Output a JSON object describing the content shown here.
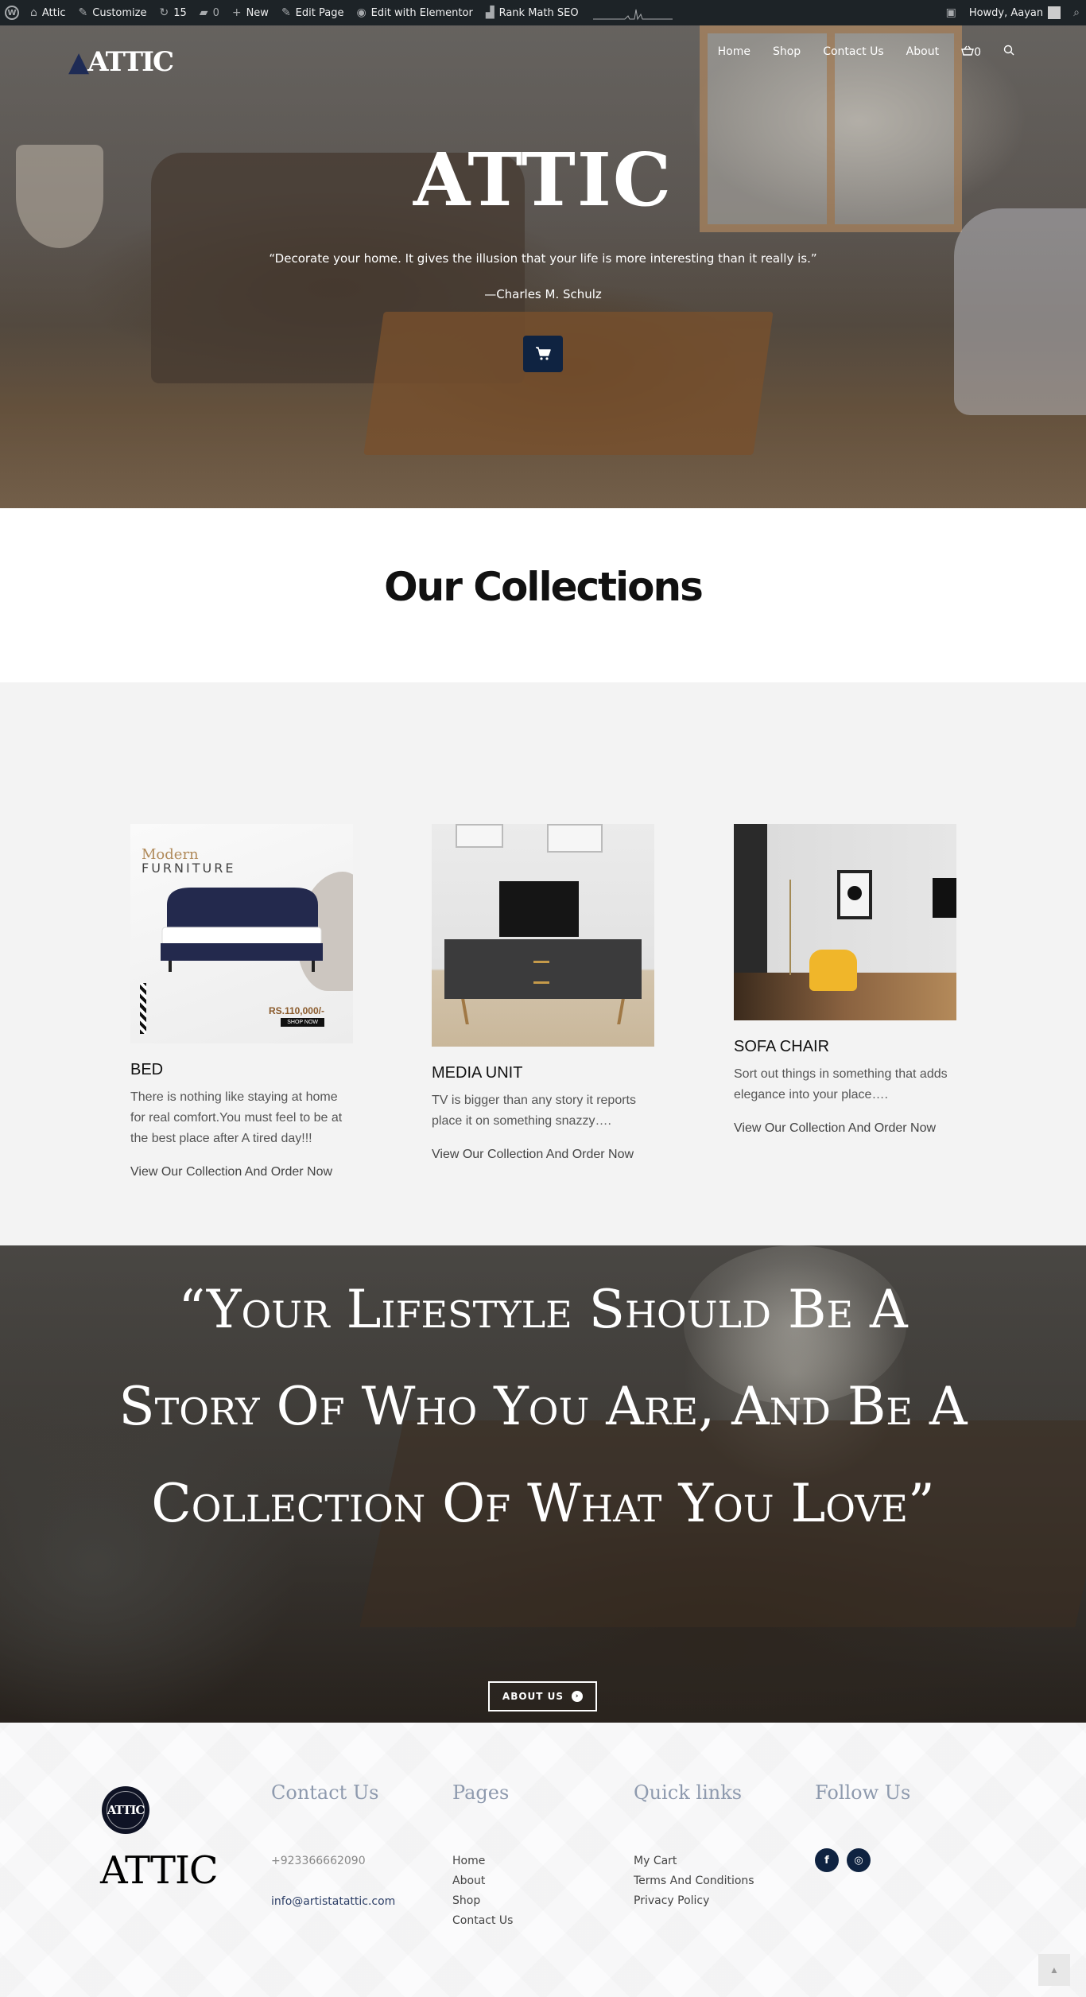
{
  "adminbar": {
    "site": "Attic",
    "customize": "Customize",
    "updates": "15",
    "comments": "0",
    "new": "New",
    "edit_page": "Edit Page",
    "elementor": "Edit with Elementor",
    "rankmath": "Rank Math SEO",
    "howdy": "Howdy, Aayan"
  },
  "nav": {
    "logo": "ATTIC",
    "items": [
      "Home",
      "Shop",
      "Contact Us",
      "About"
    ],
    "cart_count": "0"
  },
  "hero": {
    "title": "ATTIC",
    "quote": "“Decorate your home. It gives the illusion that your life is more interesting than it really is.”",
    "author": "—Charles M. Schulz"
  },
  "collections": {
    "heading": "Our Collections",
    "items": [
      {
        "title": "BED",
        "text": "There is nothing like staying at home for real comfort.You must feel to be at the best place after A tired day!!!",
        "link": "View Our Collection And Order Now",
        "image_text": {
          "line1": "Modern",
          "line2": "FURNITURE",
          "price": "RS.110,000/-",
          "cta": "SHOP NOW"
        }
      },
      {
        "title": "MEDIA UNIT",
        "text": "TV is bigger than any story it reports place it on something snazzy….",
        "link": "View Our Collection And Order Now"
      },
      {
        "title": "SOFA CHAIR",
        "text": "Sort out things in something that adds elegance into your place….",
        "link": "View Our Collection And Order Now"
      }
    ]
  },
  "quote_section": {
    "text": "“Your Lifestyle Should Be A Story Of Who You Are, And Be A Collection Of What You Love”",
    "button": "ABOUT US"
  },
  "footer": {
    "badge": "ATTIC",
    "brand": "ATTIC",
    "contact": {
      "title": "Contact Us",
      "phone": "+923366662090",
      "email": "info@artistatattic.com"
    },
    "pages": {
      "title": "Pages",
      "links": [
        "Home",
        "About",
        "Shop",
        "Contact Us"
      ]
    },
    "quick": {
      "title": "Quick links",
      "links": [
        "My Cart",
        "Terms And Conditions",
        "Privacy Policy"
      ]
    },
    "follow": {
      "title": "Follow Us",
      "facebook": "f",
      "instagram": "◎"
    }
  },
  "colors": {
    "navy": "#0f2341",
    "adminbar": "#1d2327",
    "footer_heading": "#8e9aae"
  }
}
